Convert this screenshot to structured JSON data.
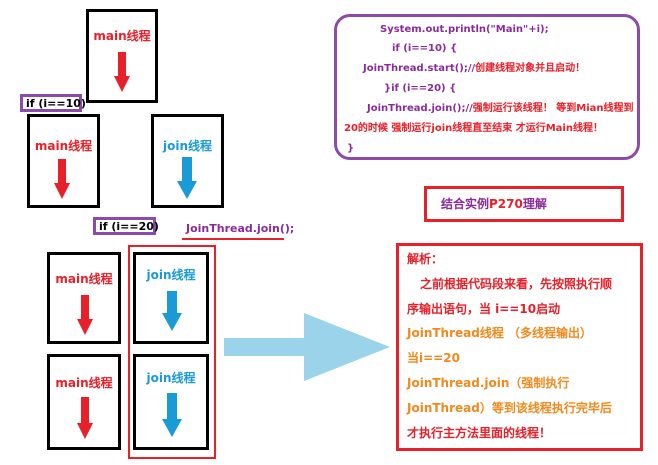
{
  "thread_boxes": {
    "top_main": "main线程",
    "mid_main": "main线程",
    "mid_join": "join线程",
    "bot1_main": "main线程",
    "bot1_join": "join线程",
    "bot2_main": "main线程",
    "bot2_join": "join线程"
  },
  "conditions": {
    "first": "if (i==10)",
    "second": "if (i==20)"
  },
  "join_call": "JoinThread.join();",
  "code_box": {
    "line1": "System.out.println(\"Main\"+i);",
    "line2": "if (i==10) {",
    "line3_code": "JoinThread.start();//",
    "line3_comment": "创建线程对象并且启动！",
    "line4": "}if (i==20) {",
    "line5_code": "JoinThread.join();//",
    "line5_comment": "强制运行该线程！ 等到Mian线程到",
    "line6": "20的时候 强制运行join线程直至结束 才运行Main线程！",
    "line7": "}"
  },
  "reference": {
    "prefix": "结合实例",
    "page": "P270",
    "suffix": "理解"
  },
  "analysis": {
    "heading": "解析：",
    "line1": "之前根据代码段来看，先按照执行顺",
    "line2": "序输出语句，当 i==10启动",
    "line3": "JoinThread线程 （多线程输出）",
    "line4": "当i==20",
    "line5": "JoinThread.join（强制执行",
    "line6": "JoinThread）等到该线程执行完毕后",
    "line7": "才执行主方法里面的线程！"
  },
  "colors": {
    "main_arrow": "#e8202a",
    "join_arrow": "#1a9ad6",
    "flow_arrow": "#9bd3ea",
    "condition_border": "#8a4ca8",
    "highlight_red": "#e8202a",
    "highlight_orange": "#f08a1e"
  }
}
